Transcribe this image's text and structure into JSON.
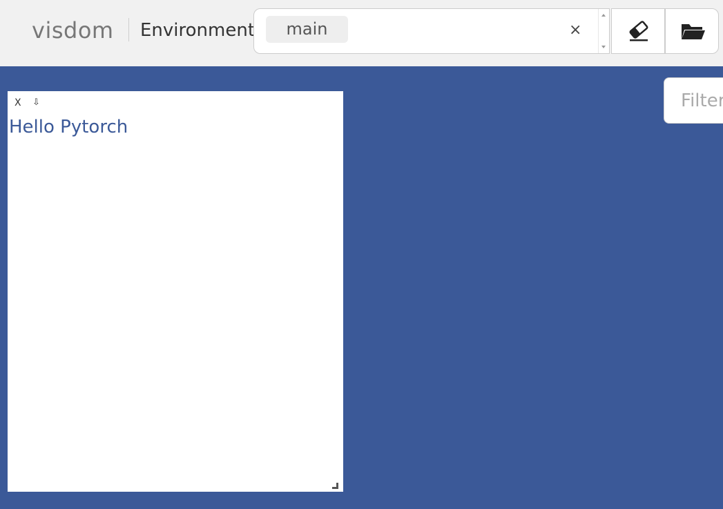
{
  "app": {
    "brand": "visdom"
  },
  "toolbar": {
    "environment_label": "Environment",
    "selected_env": "main",
    "clear_symbol": "×",
    "eraser_icon": "eraser-icon",
    "folder_icon": "folder-open-icon"
  },
  "filter": {
    "placeholder": "Filter text",
    "value": ""
  },
  "pane": {
    "close_label": "X",
    "save_icon": "⇩",
    "content": "Hello Pytorch"
  },
  "colors": {
    "background": "#3b5998",
    "accent_text": "#3b5998",
    "topbar": "#f1f1f1"
  }
}
